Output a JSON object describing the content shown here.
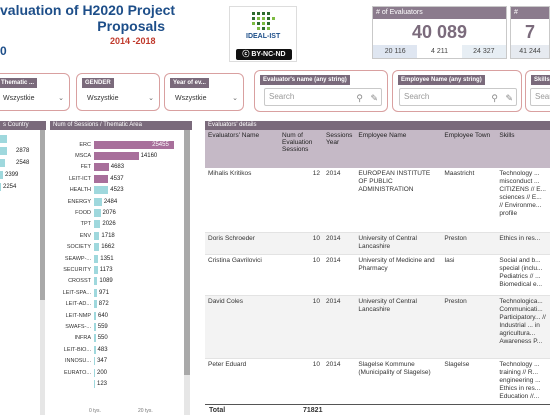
{
  "header": {
    "title_line1": "valuation of H2020 Project",
    "title_line2": "Proposals",
    "years_start": "2014",
    "years_sep": " -",
    "years_end": "2018",
    "left_number": "0",
    "logo_text": "IDEAL-IST",
    "license": "BY-NC-ND"
  },
  "cards": [
    {
      "label": "# of Evaluators",
      "value": "40 089",
      "subs": [
        "20 116",
        "4 211",
        "24 327",
        "41 244"
      ]
    },
    {
      "label": "#",
      "value": "7",
      "subs": [
        ""
      ]
    }
  ],
  "filters": [
    {
      "label": "Thematic ...",
      "value": "Wszystkie"
    },
    {
      "label": "GENDER",
      "value": "Wszystkie"
    },
    {
      "label": "Year of ev...",
      "value": "Wszystkie"
    }
  ],
  "search_filters": [
    {
      "label": "Evaluator's name (any string)",
      "placeholder": "Search"
    },
    {
      "label": "Employee Name (any string)",
      "placeholder": "Search"
    },
    {
      "label": "Skills",
      "placeholder": "Search"
    }
  ],
  "panels": {
    "country_title": "s Country",
    "thematic_title": "Num of Sessions / Thematic Area",
    "evaluators_title": "Evaluators' details"
  },
  "country_values": [
    "2878",
    "2548",
    "2399",
    "2254"
  ],
  "chart_data": {
    "type": "bar",
    "title": "Num of Sessions / Thematic Area",
    "categories": [
      "ERC",
      "MSCA",
      "FET",
      "LEIT-ICT",
      "HEALTH",
      "ENERGY",
      "FOOD",
      "TPT",
      "ENV",
      "SOCIETY",
      "SEAWP-...",
      "SECURITY",
      "CROSST",
      "LEIT-SPA...",
      "LEIT-AD...",
      "LEIT-NMP",
      "SWAFS-...",
      "INFRA",
      "LEIT-BIO...",
      "INNOSU...",
      "EURATO..."
    ],
    "values": [
      25455,
      14160,
      4683,
      4537,
      4523,
      2484,
      2076,
      2026,
      1718,
      1662,
      1351,
      1173,
      1089,
      971,
      872,
      640,
      559,
      550,
      483,
      347,
      200
    ],
    "extra_values": [
      123
    ],
    "xticks": [
      "0 tys.",
      "20 tys."
    ],
    "xlim": [
      0,
      27000
    ]
  },
  "table": {
    "columns": [
      "Evaluators' Name",
      "Num of Evaluation Sessions",
      "Sessions Year",
      "Employee Name",
      "Employee Town",
      "Skills"
    ],
    "rows": [
      {
        "name": "Mihalis Kritikos",
        "sessions": "12",
        "year": "2014",
        "employee": "EUROPEAN INSTITUTE OF PUBLIC ADMINISTRATION",
        "town": "Maastricht",
        "skills": "Technology ... misconduct ... CITIZENS // E... sciences // E... // Environme... profile"
      },
      {
        "name": "Doris Schroeder",
        "sessions": "10",
        "year": "2014",
        "employee": "University of Central Lancashire",
        "town": "Preston",
        "skills": "Ethics in res..."
      },
      {
        "name": "Cristina Gavrilovici",
        "sessions": "10",
        "year": "2014",
        "employee": "University of Medicine and Pharmacy",
        "town": "Iasi",
        "skills": "Social and b... special (inclu... Pediatrics // ... Biomedical e..."
      },
      {
        "name": "David Coles",
        "sessions": "10",
        "year": "2014",
        "employee": "University of Central Lancashire",
        "town": "Preston",
        "skills": "Technologica... Communicati... Participatory... // Industrial ... in agricultura... Awareness P..."
      },
      {
        "name": "Peter Eduard",
        "sessions": "10",
        "year": "2014",
        "employee": "Slagelse Kommune (Municipality of Slagelse)",
        "town": "Slagelse",
        "skills": "Technology ... training // R... engineering ... Ethics in res... Education //..."
      }
    ],
    "total_label": "Total",
    "total_value": "71821"
  }
}
